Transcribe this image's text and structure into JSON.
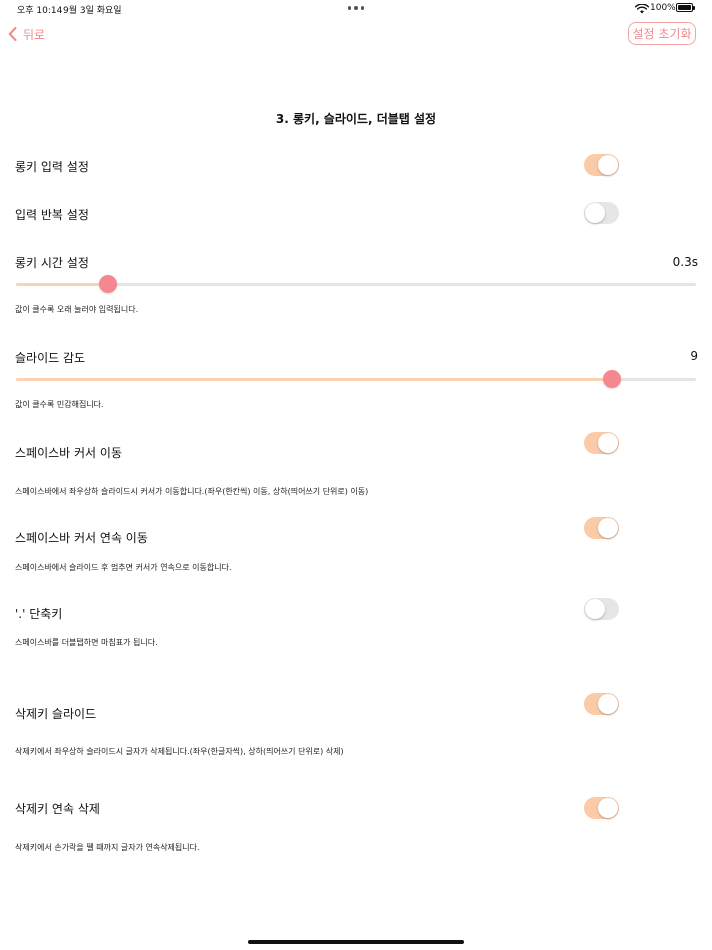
{
  "status_bar": {
    "time": "오후 10:14",
    "date": "9월 3일 화요일",
    "battery": "100%",
    "battery_level": 1.0,
    "wifi_icon": "wifi-icon",
    "battery_icon": "battery-icon"
  },
  "nav": {
    "back_label": "뒤로",
    "back_icon": "chevron-left-icon",
    "reset_label": "설정 초기화"
  },
  "page_title": "3. 롱키, 슬라이드, 더블탭 설정",
  "colors": {
    "accent": "#f08a8a",
    "toggle_on": "#fbcba8",
    "toggle_off": "#e6e6e6",
    "slider_thumb": "#f5878f",
    "slider_fill": "#fcd2b5"
  },
  "settings": {
    "longkey_input": {
      "label": "롱키 입력 설정",
      "on": true
    },
    "input_repeat": {
      "label": "입력 반복 설정",
      "on": false
    },
    "longkey_time": {
      "label": "롱키 시간 설정",
      "value_text": "0.3s",
      "value": 0.3,
      "level": 0.135,
      "desc": "값이 클수록 오래 눌러야 입력됩니다."
    },
    "slide_sensitivity": {
      "label": "슬라이드 감도",
      "value_text": "9",
      "value": 9,
      "level": 0.877,
      "desc": "값이 클수록 민감해집니다."
    },
    "space_cursor": {
      "label": "스페이스바 커서 이동",
      "on": true,
      "desc": "스페이스바에서 좌우상하 슬라이드시 커서가 이동합니다.(좌우(한칸씩) 이동, 상하(띄어쓰기 단위로) 이동)"
    },
    "space_cursor_continuous": {
      "label": "스페이스바 커서 연속 이동",
      "on": true,
      "desc": "스페이스바에서 슬라이드 후 멈추면 커서가 연속으로 이동합니다."
    },
    "period_shortcut": {
      "label": "'.' 단축키",
      "on": false,
      "desc": "스페이스바를 더블탭하면 마침표가 됩니다."
    },
    "delete_slide": {
      "label": "삭제키 슬라이드",
      "on": true,
      "desc": "삭제키에서 좌우상하 슬라이드시 글자가 삭제됩니다.(좌우(한글자씩), 상하(띄어쓰기 단위로) 삭제)"
    },
    "delete_continuous": {
      "label": "삭제키 연속 삭제",
      "on": true,
      "desc": "삭제키에서 손가락을 뗄 때까지 글자가 연속삭제됩니다."
    }
  }
}
